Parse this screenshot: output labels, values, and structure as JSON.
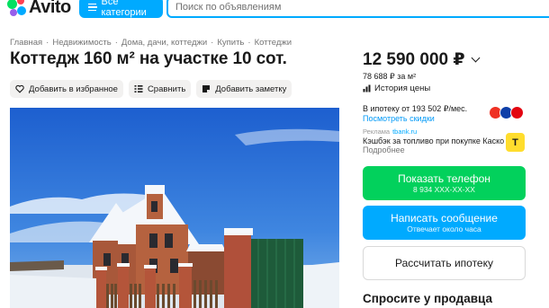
{
  "header": {
    "logo_text": "Avito",
    "categories_label": "Все категории",
    "search_placeholder": "Поиск по объявлениям"
  },
  "breadcrumb": [
    "Главная",
    "Недвижимость",
    "Дома, дачи, коттеджи",
    "Купить",
    "Коттеджи"
  ],
  "title": "Коттедж 160 м² на участке 10 сот.",
  "actions": {
    "favorite": "Добавить в избранное",
    "compare": "Сравнить",
    "note": "Добавить заметку"
  },
  "price": {
    "value": "12 590 000 ₽",
    "per_meter": "78 688 ₽ за м²",
    "history": "История цены"
  },
  "mortgage": {
    "text": "В ипотеку от 193 502 ₽/мес.",
    "link": "Посмотреть скидки"
  },
  "ad": {
    "label": "Реклама",
    "domain": "tbank.ru",
    "text": "Кэшбэк за топливо при покупке Каско",
    "more": "Подробнее",
    "logo_letter": "T"
  },
  "buttons": {
    "phone": "Показать телефон",
    "phone_number": "8 934 XXX-XX-XX",
    "message": "Написать сообщение",
    "reply_time": "Отвечает около часа",
    "mortgage_calc": "Рассчитать ипотеку"
  },
  "ask_seller": "Спросите у продавца",
  "colors": {
    "accent_blue": "#00aaff",
    "phone_green": "#02d15c",
    "link_blue": "#0099f7"
  }
}
